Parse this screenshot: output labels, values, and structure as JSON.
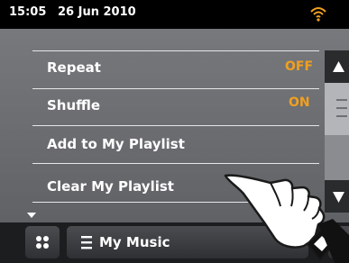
{
  "status": {
    "time": "15:05",
    "date": "26 Jun 2010",
    "wifi_icon": "wifi-icon"
  },
  "menu": {
    "items": [
      {
        "label": "Repeat",
        "value": "OFF"
      },
      {
        "label": "Shuffle",
        "value": "ON"
      },
      {
        "label": "Add to My Playlist",
        "value": ""
      },
      {
        "label": "Clear My Playlist",
        "value": ""
      }
    ]
  },
  "bottom": {
    "title": "My Music",
    "home_icon": "grid-home-icon",
    "list_icon": "menu-list-icon",
    "volume_icon": "speaker-icon"
  },
  "colors": {
    "accent_value": "#f0a020",
    "status_bar": "#000000",
    "wifi": "#f0a020"
  }
}
